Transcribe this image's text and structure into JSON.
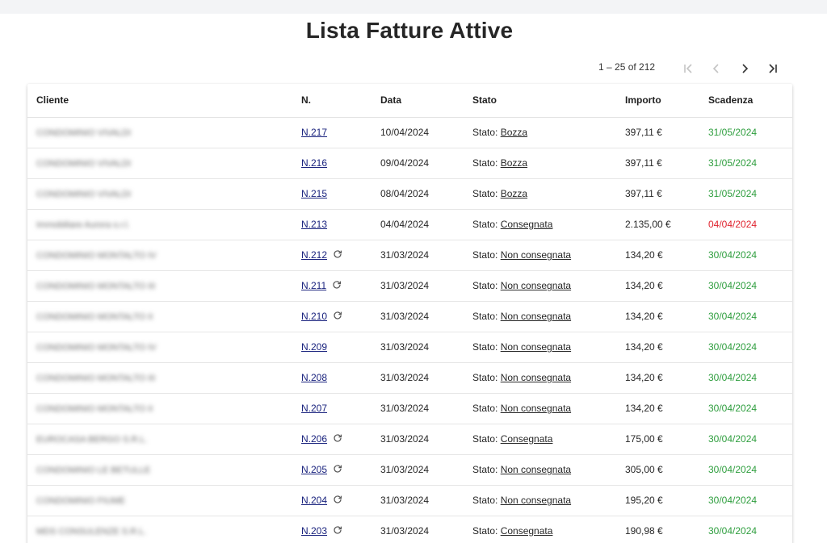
{
  "page": {
    "title": "Lista Fatture Attive"
  },
  "paginator": {
    "range_label": "1 – 25 of 212"
  },
  "colors": {
    "due_ok": "#2e9e3e",
    "due_late": "#e0242f",
    "link": "#1a237e"
  },
  "table": {
    "headers": {
      "cliente": "Cliente",
      "numero": "N.",
      "data": "Data",
      "stato": "Stato",
      "importo": "Importo",
      "scadenza": "Scadenza"
    },
    "stato_prefix": "Stato: ",
    "rows": [
      {
        "cliente": "CONDOMINIO VIVALDI",
        "numero": "N.217",
        "sync": false,
        "data": "10/04/2024",
        "stato": "Bozza",
        "importo": "397,11 €",
        "scadenza": "31/05/2024",
        "late": false
      },
      {
        "cliente": "CONDOMINIO VIVALDI",
        "numero": "N.216",
        "sync": false,
        "data": "09/04/2024",
        "stato": "Bozza",
        "importo": "397,11 €",
        "scadenza": "31/05/2024",
        "late": false
      },
      {
        "cliente": "CONDOMINIO VIVALDI",
        "numero": "N.215",
        "sync": false,
        "data": "08/04/2024",
        "stato": "Bozza",
        "importo": "397,11 €",
        "scadenza": "31/05/2024",
        "late": false
      },
      {
        "cliente": "Immobiliare Aurora s.r.l.",
        "numero": "N.213",
        "sync": false,
        "data": "04/04/2024",
        "stato": "Consegnata",
        "importo": "2.135,00 €",
        "scadenza": "04/04/2024",
        "late": true
      },
      {
        "cliente": "CONDOMINIO MONTALTO IV",
        "numero": "N.212",
        "sync": true,
        "data": "31/03/2024",
        "stato": "Non consegnata",
        "importo": "134,20 €",
        "scadenza": "30/04/2024",
        "late": false
      },
      {
        "cliente": "CONDOMINIO MONTALTO III",
        "numero": "N.211",
        "sync": true,
        "data": "31/03/2024",
        "stato": "Non consegnata",
        "importo": "134,20 €",
        "scadenza": "30/04/2024",
        "late": false
      },
      {
        "cliente": "CONDOMINIO MONTALTO II",
        "numero": "N.210",
        "sync": true,
        "data": "31/03/2024",
        "stato": "Non consegnata",
        "importo": "134,20 €",
        "scadenza": "30/04/2024",
        "late": false
      },
      {
        "cliente": "CONDOMINIO MONTALTO IV",
        "numero": "N.209",
        "sync": false,
        "data": "31/03/2024",
        "stato": "Non consegnata",
        "importo": "134,20 €",
        "scadenza": "30/04/2024",
        "late": false
      },
      {
        "cliente": "CONDOMINIO MONTALTO III",
        "numero": "N.208",
        "sync": false,
        "data": "31/03/2024",
        "stato": "Non consegnata",
        "importo": "134,20 €",
        "scadenza": "30/04/2024",
        "late": false
      },
      {
        "cliente": "CONDOMINIO MONTALTO II",
        "numero": "N.207",
        "sync": false,
        "data": "31/03/2024",
        "stato": "Non consegnata",
        "importo": "134,20 €",
        "scadenza": "30/04/2024",
        "late": false
      },
      {
        "cliente": "EUROCASA BERGO S.R.L.",
        "numero": "N.206",
        "sync": true,
        "data": "31/03/2024",
        "stato": "Consegnata",
        "importo": "175,00 €",
        "scadenza": "30/04/2024",
        "late": false
      },
      {
        "cliente": "CONDOMINIO LE BETULLE",
        "numero": "N.205",
        "sync": true,
        "data": "31/03/2024",
        "stato": "Non consegnata",
        "importo": "305,00 €",
        "scadenza": "30/04/2024",
        "late": false
      },
      {
        "cliente": "CONDOMINIO FIUME",
        "numero": "N.204",
        "sync": true,
        "data": "31/03/2024",
        "stato": "Non consegnata",
        "importo": "195,20 €",
        "scadenza": "30/04/2024",
        "late": false
      },
      {
        "cliente": "MDS CONSULENZE S.R.L.",
        "numero": "N.203",
        "sync": true,
        "data": "31/03/2024",
        "stato": "Consegnata",
        "importo": "190,98 €",
        "scadenza": "30/04/2024",
        "late": false
      }
    ]
  }
}
